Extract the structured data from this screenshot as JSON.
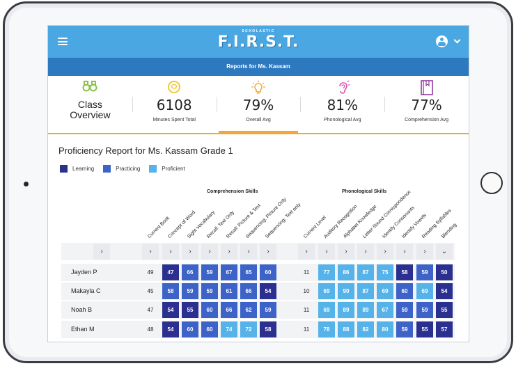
{
  "app": {
    "logo_small": "SCHOLASTIC",
    "logo_big": "F.I.R.S.T.",
    "subtitle": "Reports for Ms. Kassam"
  },
  "colors": {
    "header": "#4aa7e2",
    "subheader": "#2d79bf",
    "accent": "#f0a63a",
    "learning": "#2b2f8f",
    "practicing": "#3d63c9",
    "proficient": "#56b3ea"
  },
  "stats": {
    "class_overview_line1": "Class",
    "class_overview_line2": "Overview",
    "minutes_value": "6108",
    "minutes_label": "Minutes Spent Total",
    "overall_value": "79%",
    "overall_label": "Overall Avg",
    "phonological_value": "81%",
    "phonological_label": "Phonological Avg",
    "comprehension_value": "77%",
    "comprehension_label": "Comprehension Avg"
  },
  "report": {
    "title": "Proficiency Report for Ms. Kassam Grade 1",
    "legend": [
      "Learning",
      "Practicing",
      "Proficient"
    ],
    "comprehension_group": "Comprehension Skills",
    "phonological_group": "Phonological Skills",
    "comprehension_columns": [
      "Current Book",
      "Concept of Word",
      "Sight Vocabulary",
      "Recall: Text Only",
      "Recall: Picture & Text",
      "Sequencing: Picture Only",
      "Sequencing: Text only"
    ],
    "phonological_columns": [
      "Current Level",
      "Auditory Recognition",
      "Alphabet Knowledge",
      "Letter-Sound Correspondence",
      "Identify Consonants",
      "Identify Vowels",
      "Reading Syllables",
      "Blending"
    ],
    "header_glyph": "›",
    "last_header_glyph": "⌄",
    "students": [
      {
        "name": "Jayden P",
        "book": "49",
        "comp": [
          [
            "47",
            "L"
          ],
          [
            "66",
            "P"
          ],
          [
            "59",
            "P"
          ],
          [
            "67",
            "P"
          ],
          [
            "65",
            "P"
          ],
          [
            "60",
            "P"
          ]
        ],
        "level": "11",
        "phon": [
          [
            "77",
            "F"
          ],
          [
            "86",
            "F"
          ],
          [
            "87",
            "F"
          ],
          [
            "75",
            "F"
          ],
          [
            "58",
            "L"
          ],
          [
            "59",
            "P"
          ],
          [
            "50",
            "L"
          ]
        ]
      },
      {
        "name": "Makayla C",
        "book": "45",
        "comp": [
          [
            "58",
            "P"
          ],
          [
            "59",
            "P"
          ],
          [
            "59",
            "P"
          ],
          [
            "61",
            "P"
          ],
          [
            "66",
            "P"
          ],
          [
            "54",
            "L"
          ]
        ],
        "level": "10",
        "phon": [
          [
            "69",
            "F"
          ],
          [
            "90",
            "F"
          ],
          [
            "87",
            "F"
          ],
          [
            "69",
            "F"
          ],
          [
            "60",
            "P"
          ],
          [
            "69",
            "F"
          ],
          [
            "54",
            "L"
          ]
        ]
      },
      {
        "name": "Noah B",
        "book": "47",
        "comp": [
          [
            "54",
            "L"
          ],
          [
            "55",
            "L"
          ],
          [
            "60",
            "P"
          ],
          [
            "66",
            "P"
          ],
          [
            "62",
            "P"
          ],
          [
            "59",
            "P"
          ]
        ],
        "level": "11",
        "phon": [
          [
            "69",
            "F"
          ],
          [
            "89",
            "F"
          ],
          [
            "89",
            "F"
          ],
          [
            "67",
            "F"
          ],
          [
            "59",
            "P"
          ],
          [
            "59",
            "P"
          ],
          [
            "55",
            "L"
          ]
        ]
      },
      {
        "name": "Ethan M",
        "book": "48",
        "comp": [
          [
            "54",
            "L"
          ],
          [
            "60",
            "P"
          ],
          [
            "60",
            "P"
          ],
          [
            "74",
            "F"
          ],
          [
            "72",
            "F"
          ],
          [
            "58",
            "L"
          ]
        ],
        "level": "11",
        "phon": [
          [
            "78",
            "F"
          ],
          [
            "88",
            "F"
          ],
          [
            "82",
            "F"
          ],
          [
            "80",
            "F"
          ],
          [
            "59",
            "P"
          ],
          [
            "55",
            "L"
          ],
          [
            "57",
            "L"
          ]
        ]
      }
    ]
  }
}
